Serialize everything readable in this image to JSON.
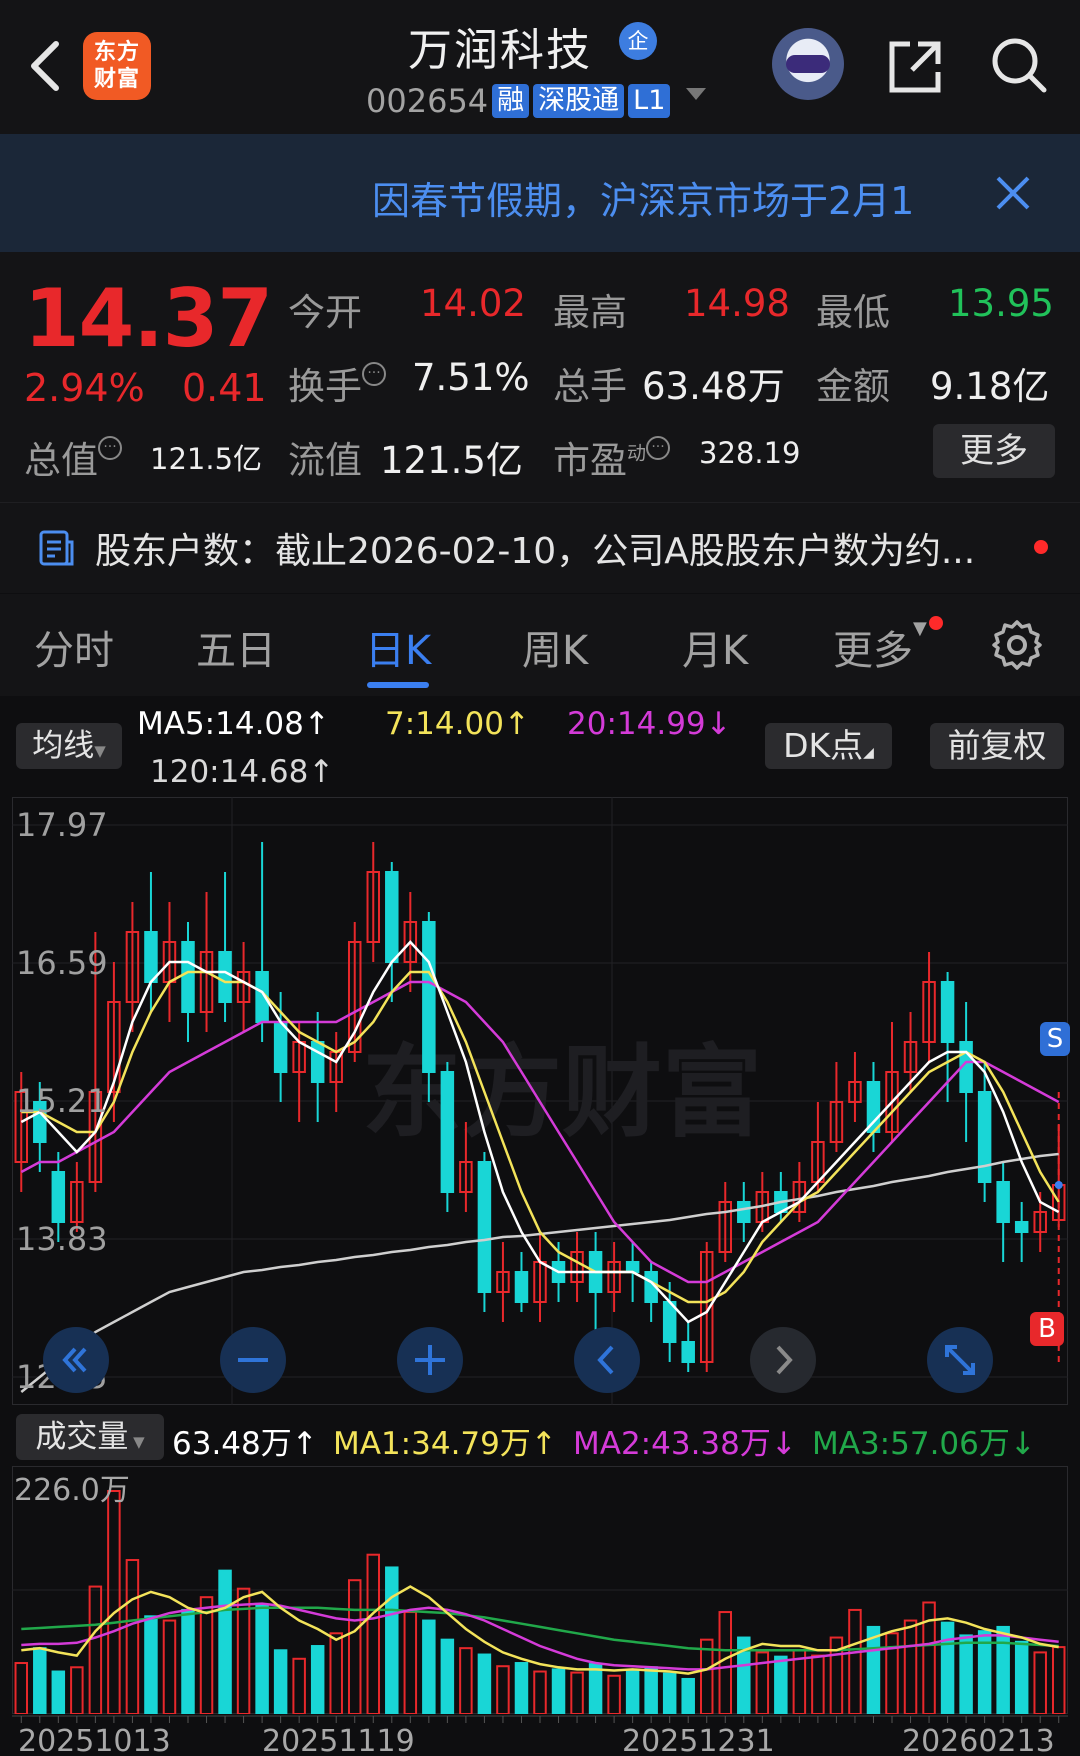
{
  "header": {
    "logo_text_line1": "东方",
    "logo_text_line2": "财富",
    "stock_name": "万润科技",
    "qi_badge": "企",
    "stock_code": "002654",
    "tags": [
      "融",
      "深股通",
      "L1"
    ],
    "icons": [
      "back-icon",
      "assistant-robot-icon",
      "share-icon",
      "search-icon"
    ]
  },
  "notice": {
    "text": "因春节假期，沪深京市场于2月1",
    "close_icon": "close-icon"
  },
  "quote": {
    "price": "14.37",
    "change_pct": "2.94%",
    "change_amt": "0.41",
    "open_label": "今开",
    "open_value": "14.02",
    "high_label": "最高",
    "high_value": "14.98",
    "low_label": "最低",
    "low_value": "13.95",
    "turnover_label": "换手",
    "turnover_value": "7.51%",
    "volume_label": "总手",
    "volume_value": "63.48万",
    "amount_label": "金额",
    "amount_value": "9.18亿",
    "mktcap_label": "总值",
    "mktcap_value": "121.5亿",
    "float_label": "流值",
    "float_value": "121.5亿",
    "pe_label": "市盈",
    "pe_sup": "动",
    "pe_value": "328.19",
    "more_button": "更多",
    "colors": {
      "up": "#e8282b",
      "down": "#21c25a"
    }
  },
  "shareholder": {
    "text": "股东户数：截止2026-02-10，公司A股股东户数为约..."
  },
  "tabs": {
    "items": [
      "分时",
      "五日",
      "日K",
      "周K",
      "月K",
      "更多"
    ],
    "active": "日K"
  },
  "ma_bar": {
    "selector": "均线",
    "ma5": "MA5:14.08",
    "ma7": "7:14.00",
    "ma20": "20:14.99",
    "ma120": "120:14.68",
    "dk_button": "DK点",
    "adjust_button": "前复权",
    "colors": {
      "ma5": "#ffffff",
      "ma7": "#f3e35a",
      "ma20": "#d43bd8",
      "ma120": "#d9d9d9"
    }
  },
  "price_axis": [
    "17.97",
    "16.59",
    "15.21",
    "13.83",
    "12.45"
  ],
  "watermark": "东方财富",
  "signals": {
    "sell": "S",
    "buy": "B"
  },
  "volume_bar": {
    "selector": "成交量",
    "vol": "63.48万",
    "ma1": "MA1:34.79万",
    "ma2": "MA2:43.38万",
    "ma3": "MA3:57.06万",
    "axis_top": "226.0万"
  },
  "dates": [
    "20251013",
    "20251119",
    "20251231",
    "20260213"
  ],
  "chart_data": {
    "type": "candlestick",
    "ylim": [
      12.45,
      17.97
    ],
    "y_ticks": [
      17.97,
      16.59,
      15.21,
      13.83,
      12.45
    ],
    "x_labels": [
      "20251013",
      "20251119",
      "20251231",
      "20260213"
    ],
    "candles": [
      {
        "o": 14.6,
        "c": 15.3,
        "h": 15.5,
        "l": 14.3,
        "up": true
      },
      {
        "o": 15.2,
        "c": 14.8,
        "h": 15.4,
        "l": 14.5,
        "up": false
      },
      {
        "o": 14.5,
        "c": 14.0,
        "h": 14.7,
        "l": 13.8,
        "up": false
      },
      {
        "o": 14.0,
        "c": 14.4,
        "h": 14.6,
        "l": 13.9,
        "up": true
      },
      {
        "o": 14.4,
        "c": 15.3,
        "h": 16.9,
        "l": 14.3,
        "up": true
      },
      {
        "o": 15.3,
        "c": 16.2,
        "h": 16.6,
        "l": 15.0,
        "up": true
      },
      {
        "o": 16.2,
        "c": 16.9,
        "h": 17.2,
        "l": 15.9,
        "up": true
      },
      {
        "o": 16.9,
        "c": 16.4,
        "h": 17.5,
        "l": 16.1,
        "up": false
      },
      {
        "o": 16.4,
        "c": 16.8,
        "h": 17.2,
        "l": 16.0,
        "up": true
      },
      {
        "o": 16.8,
        "c": 16.1,
        "h": 17.0,
        "l": 15.8,
        "up": false
      },
      {
        "o": 16.1,
        "c": 16.7,
        "h": 17.3,
        "l": 15.9,
        "up": true
      },
      {
        "o": 16.7,
        "c": 16.2,
        "h": 17.5,
        "l": 16.0,
        "up": false
      },
      {
        "o": 16.2,
        "c": 16.5,
        "h": 16.8,
        "l": 15.9,
        "up": true
      },
      {
        "o": 16.5,
        "c": 16.0,
        "h": 17.8,
        "l": 15.8,
        "up": false
      },
      {
        "o": 16.0,
        "c": 15.5,
        "h": 16.3,
        "l": 15.2,
        "up": false
      },
      {
        "o": 15.5,
        "c": 15.8,
        "h": 16.0,
        "l": 15.0,
        "up": true
      },
      {
        "o": 15.8,
        "c": 15.4,
        "h": 16.1,
        "l": 15.0,
        "up": false
      },
      {
        "o": 15.4,
        "c": 15.7,
        "h": 15.9,
        "l": 15.1,
        "up": true
      },
      {
        "o": 15.7,
        "c": 16.8,
        "h": 17.0,
        "l": 15.6,
        "up": true
      },
      {
        "o": 16.8,
        "c": 17.5,
        "h": 17.8,
        "l": 16.6,
        "up": true
      },
      {
        "o": 17.5,
        "c": 16.6,
        "h": 17.6,
        "l": 16.2,
        "up": false
      },
      {
        "o": 16.6,
        "c": 17.0,
        "h": 17.3,
        "l": 16.3,
        "up": true
      },
      {
        "o": 17.0,
        "c": 15.5,
        "h": 17.1,
        "l": 15.2,
        "up": false
      },
      {
        "o": 15.5,
        "c": 14.3,
        "h": 15.6,
        "l": 14.1,
        "up": false
      },
      {
        "o": 14.3,
        "c": 14.6,
        "h": 15.0,
        "l": 14.1,
        "up": true
      },
      {
        "o": 14.6,
        "c": 13.3,
        "h": 14.7,
        "l": 13.1,
        "up": false
      },
      {
        "o": 13.3,
        "c": 13.5,
        "h": 13.8,
        "l": 13.0,
        "up": true
      },
      {
        "o": 13.5,
        "c": 13.2,
        "h": 13.7,
        "l": 13.1,
        "up": false
      },
      {
        "o": 13.2,
        "c": 13.6,
        "h": 13.9,
        "l": 13.0,
        "up": true
      },
      {
        "o": 13.6,
        "c": 13.4,
        "h": 13.8,
        "l": 13.2,
        "up": false
      },
      {
        "o": 13.4,
        "c": 13.7,
        "h": 13.9,
        "l": 13.2,
        "up": true
      },
      {
        "o": 13.7,
        "c": 13.3,
        "h": 13.9,
        "l": 12.9,
        "up": false
      },
      {
        "o": 13.3,
        "c": 13.6,
        "h": 13.8,
        "l": 13.1,
        "up": true
      },
      {
        "o": 13.6,
        "c": 13.5,
        "h": 13.8,
        "l": 13.2,
        "up": false
      },
      {
        "o": 13.5,
        "c": 13.2,
        "h": 13.6,
        "l": 13.0,
        "up": false
      },
      {
        "o": 13.2,
        "c": 12.8,
        "h": 13.4,
        "l": 12.6,
        "up": false
      },
      {
        "o": 12.8,
        "c": 12.6,
        "h": 13.0,
        "l": 12.5,
        "up": false
      },
      {
        "o": 12.6,
        "c": 13.7,
        "h": 13.8,
        "l": 12.5,
        "up": true
      },
      {
        "o": 13.7,
        "c": 14.2,
        "h": 14.4,
        "l": 13.6,
        "up": true
      },
      {
        "o": 14.2,
        "c": 14.0,
        "h": 14.4,
        "l": 13.8,
        "up": false
      },
      {
        "o": 14.0,
        "c": 14.3,
        "h": 14.5,
        "l": 13.9,
        "up": true
      },
      {
        "o": 14.3,
        "c": 14.1,
        "h": 14.5,
        "l": 14.0,
        "up": false
      },
      {
        "o": 14.1,
        "c": 14.4,
        "h": 14.6,
        "l": 14.0,
        "up": true
      },
      {
        "o": 14.4,
        "c": 14.8,
        "h": 15.2,
        "l": 14.3,
        "up": true
      },
      {
        "o": 14.8,
        "c": 15.2,
        "h": 15.6,
        "l": 14.7,
        "up": true
      },
      {
        "o": 15.2,
        "c": 15.4,
        "h": 15.7,
        "l": 15.0,
        "up": true
      },
      {
        "o": 15.4,
        "c": 14.9,
        "h": 15.6,
        "l": 14.7,
        "up": false
      },
      {
        "o": 14.9,
        "c": 15.5,
        "h": 16.0,
        "l": 14.8,
        "up": true
      },
      {
        "o": 15.5,
        "c": 15.8,
        "h": 16.1,
        "l": 15.3,
        "up": true
      },
      {
        "o": 15.8,
        "c": 16.4,
        "h": 16.7,
        "l": 15.6,
        "up": true
      },
      {
        "o": 16.4,
        "c": 15.8,
        "h": 16.5,
        "l": 15.2,
        "up": false
      },
      {
        "o": 15.8,
        "c": 15.3,
        "h": 16.2,
        "l": 14.8,
        "up": false
      },
      {
        "o": 15.3,
        "c": 14.4,
        "h": 15.6,
        "l": 14.2,
        "up": false
      },
      {
        "o": 14.4,
        "c": 14.0,
        "h": 14.6,
        "l": 13.6,
        "up": false
      },
      {
        "o": 14.0,
        "c": 13.9,
        "h": 14.2,
        "l": 13.6,
        "up": false
      },
      {
        "o": 13.9,
        "c": 14.1,
        "h": 14.3,
        "l": 13.7,
        "up": true
      },
      {
        "o": 14.02,
        "c": 14.37,
        "h": 14.98,
        "l": 13.95,
        "up": true
      }
    ],
    "ma_series": {
      "MA5": [
        15.0,
        15.1,
        14.9,
        14.7,
        14.9,
        15.4,
        16.0,
        16.4,
        16.6,
        16.6,
        16.5,
        16.5,
        16.4,
        16.3,
        16.0,
        15.8,
        15.7,
        15.6,
        15.9,
        16.3,
        16.6,
        16.8,
        16.6,
        16.1,
        15.6,
        14.9,
        14.3,
        13.9,
        13.6,
        13.5,
        13.5,
        13.5,
        13.5,
        13.5,
        13.4,
        13.2,
        13.0,
        13.1,
        13.4,
        13.7,
        14.0,
        14.1,
        14.2,
        14.4,
        14.6,
        14.8,
        15.0,
        15.2,
        15.4,
        15.6,
        15.7,
        15.7,
        15.5,
        15.1,
        14.6,
        14.2,
        14.1
      ],
      "MA7": [
        15.1,
        15.1,
        15.0,
        14.9,
        14.9,
        15.2,
        15.7,
        16.1,
        16.4,
        16.5,
        16.5,
        16.4,
        16.4,
        16.3,
        16.1,
        15.9,
        15.8,
        15.7,
        15.8,
        16.0,
        16.3,
        16.5,
        16.5,
        16.2,
        15.8,
        15.3,
        14.8,
        14.3,
        13.9,
        13.7,
        13.6,
        13.5,
        13.5,
        13.5,
        13.4,
        13.3,
        13.2,
        13.2,
        13.3,
        13.5,
        13.8,
        14.0,
        14.2,
        14.3,
        14.5,
        14.7,
        14.9,
        15.1,
        15.3,
        15.5,
        15.6,
        15.7,
        15.6,
        15.3,
        14.9,
        14.5,
        14.2
      ],
      "MA20": [
        14.5,
        14.6,
        14.6,
        14.7,
        14.8,
        14.9,
        15.1,
        15.3,
        15.5,
        15.6,
        15.7,
        15.8,
        15.9,
        16.0,
        16.0,
        16.0,
        16.0,
        16.0,
        16.1,
        16.2,
        16.3,
        16.4,
        16.4,
        16.3,
        16.2,
        16.0,
        15.8,
        15.5,
        15.2,
        14.9,
        14.6,
        14.3,
        14.0,
        13.8,
        13.6,
        13.5,
        13.4,
        13.4,
        13.5,
        13.6,
        13.7,
        13.8,
        13.9,
        14.0,
        14.2,
        14.4,
        14.6,
        14.8,
        15.0,
        15.2,
        15.4,
        15.6,
        15.6,
        15.5,
        15.4,
        15.3,
        15.2
      ],
      "MA120": [
        12.3,
        12.45,
        12.6,
        12.75,
        12.9,
        13.0,
        13.1,
        13.2,
        13.3,
        13.35,
        13.4,
        13.45,
        13.5,
        13.52,
        13.55,
        13.57,
        13.6,
        13.62,
        13.65,
        13.67,
        13.7,
        13.72,
        13.75,
        13.77,
        13.8,
        13.82,
        13.85,
        13.86,
        13.88,
        13.9,
        13.92,
        13.94,
        13.96,
        13.98,
        14.0,
        14.02,
        14.05,
        14.08,
        14.1,
        14.13,
        14.16,
        14.2,
        14.23,
        14.26,
        14.3,
        14.33,
        14.36,
        14.4,
        14.43,
        14.46,
        14.5,
        14.53,
        14.56,
        14.6,
        14.63,
        14.66,
        14.68
      ]
    },
    "volume": {
      "ylim": [
        0,
        226.0
      ],
      "unit": "万",
      "bars": [
        48,
        62,
        40,
        44,
        120,
        210,
        145,
        92,
        88,
        98,
        110,
        135,
        118,
        102,
        60,
        52,
        64,
        76,
        126,
        150,
        138,
        96,
        88,
        70,
        62,
        56,
        45,
        48,
        40,
        42,
        39,
        47,
        36,
        41,
        44,
        38,
        33,
        70,
        96,
        72,
        58,
        54,
        60,
        55,
        72,
        98,
        82,
        76,
        88,
        105,
        86,
        74,
        78,
        82,
        68,
        58,
        63
      ],
      "up": [
        true,
        false,
        false,
        true,
        true,
        true,
        true,
        false,
        true,
        false,
        true,
        false,
        true,
        false,
        false,
        true,
        false,
        true,
        true,
        true,
        false,
        true,
        false,
        false,
        true,
        false,
        true,
        false,
        true,
        false,
        true,
        false,
        true,
        false,
        false,
        false,
        false,
        true,
        true,
        false,
        true,
        false,
        true,
        true,
        true,
        true,
        false,
        true,
        true,
        true,
        false,
        false,
        false,
        false,
        false,
        true,
        true
      ],
      "MA1": [
        60,
        62,
        58,
        55,
        78,
        95,
        108,
        115,
        110,
        100,
        95,
        100,
        110,
        115,
        100,
        88,
        80,
        70,
        78,
        95,
        110,
        120,
        110,
        95,
        80,
        68,
        58,
        52,
        47,
        44,
        42,
        42,
        41,
        42,
        41,
        40,
        38,
        42,
        52,
        60,
        66,
        64,
        64,
        60,
        60,
        66,
        72,
        78,
        82,
        88,
        90,
        86,
        80,
        76,
        72,
        66,
        63
      ],
      "MA2": [
        65,
        66,
        66,
        67,
        72,
        78,
        85,
        90,
        95,
        98,
        100,
        102,
        103,
        104,
        102,
        98,
        94,
        90,
        88,
        90,
        94,
        98,
        100,
        98,
        94,
        88,
        80,
        72,
        64,
        58,
        52,
        48,
        46,
        45,
        44,
        43,
        42,
        42,
        44,
        46,
        48,
        50,
        52,
        54,
        56,
        58,
        60,
        62,
        64,
        66,
        70,
        72,
        74,
        74,
        72,
        70,
        68
      ],
      "MA3": [
        80,
        81,
        82,
        83,
        84,
        86,
        88,
        90,
        92,
        94,
        96,
        98,
        99,
        100,
        100,
        100,
        100,
        99,
        98,
        98,
        98,
        97,
        96,
        95,
        93,
        91,
        88,
        85,
        82,
        79,
        76,
        73,
        70,
        68,
        66,
        64,
        62,
        61,
        60,
        60,
        60,
        60,
        60,
        60,
        60,
        61,
        62,
        63,
        64,
        65,
        66,
        67,
        67,
        67,
        66,
        65,
        64
      ]
    }
  }
}
